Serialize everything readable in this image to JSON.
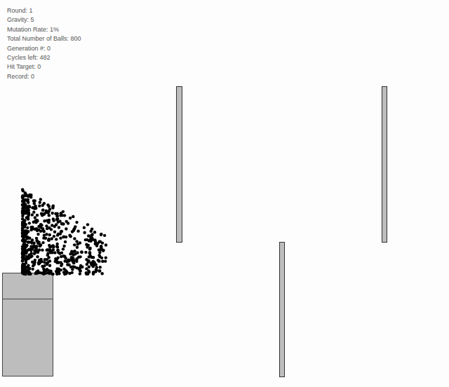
{
  "stats": [
    "Round: 1",
    "Gravity: 5",
    "Mutation Rate: 1%",
    "Total Number of Balls: 800",
    "Generation #: 0",
    "Cycles left: 482",
    "Hit Target: 0",
    "Record: 0"
  ]
}
